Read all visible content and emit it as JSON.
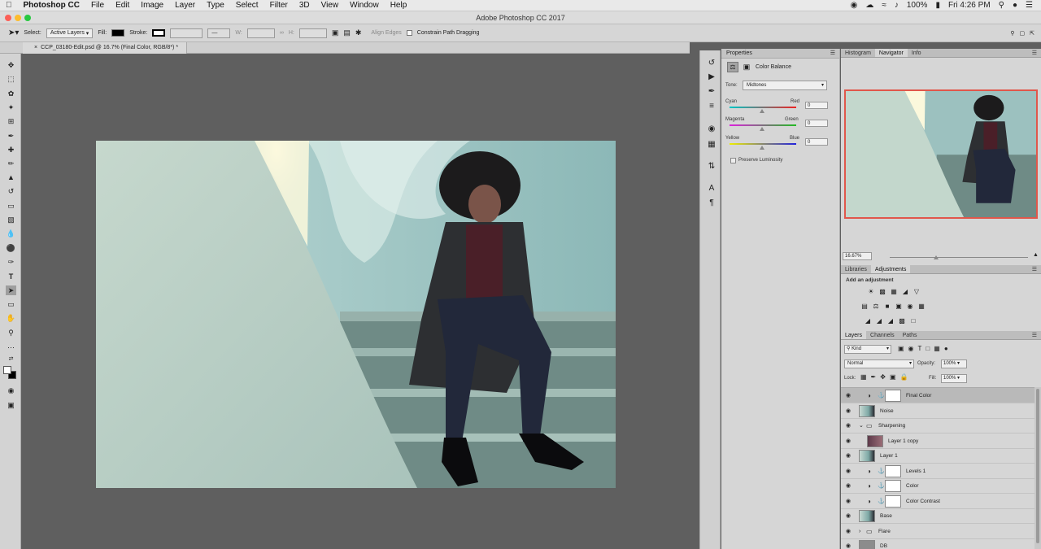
{
  "menubar": {
    "apple": "",
    "app_name": "Photoshop CC",
    "items": [
      "File",
      "Edit",
      "Image",
      "Layer",
      "Type",
      "Select",
      "Filter",
      "3D",
      "View",
      "Window",
      "Help"
    ],
    "battery": "100%",
    "time": "Fri 4:26 PM"
  },
  "window_title": "Adobe Photoshop CC 2017",
  "options": {
    "select_label": "Select:",
    "select_value": "Active Layers",
    "fill_label": "Fill:",
    "stroke_label": "Stroke:",
    "w_label": "W:",
    "h_label": "H:",
    "align_edges": "Align Edges",
    "constrain": "Constrain Path Dragging"
  },
  "document_tab": "CCP_03180-Edit.psd @ 16.7% (Final Color, RGB/8*) *",
  "properties": {
    "title": "Properties",
    "adjustment": "Color Balance",
    "tone_label": "Tone:",
    "tone_value": "Midtones",
    "sliders": [
      {
        "left": "Cyan",
        "right": "Red",
        "value": "0"
      },
      {
        "left": "Magenta",
        "right": "Green",
        "value": "0"
      },
      {
        "left": "Yellow",
        "right": "Blue",
        "value": "0"
      }
    ],
    "preserve": "Preserve Luminosity"
  },
  "nav_tabs": [
    "Histogram",
    "Navigator",
    "Info"
  ],
  "zoom": "16.67%",
  "adj_tabs": [
    "Libraries",
    "Adjustments"
  ],
  "add_adjustment": "Add an adjustment",
  "layer_tabs": [
    "Layers",
    "Channels",
    "Paths"
  ],
  "layers_panel": {
    "kind": "Kind",
    "blend": "Normal",
    "opacity_label": "Opacity:",
    "opacity": "100%",
    "lock_label": "Lock:",
    "fill_label": "Fill:",
    "fill": "100%"
  },
  "layers": [
    {
      "name": "Final Color",
      "type": "adj",
      "selected": true
    },
    {
      "name": "Noise",
      "type": "photo"
    },
    {
      "name": "Sharpening",
      "type": "group-open"
    },
    {
      "name": "Layer 1 copy",
      "type": "photo-dark"
    },
    {
      "name": "Layer 1",
      "type": "photo"
    },
    {
      "name": "Levels 1",
      "type": "adj"
    },
    {
      "name": "Color",
      "type": "adj"
    },
    {
      "name": "Color Contrast",
      "type": "adj"
    },
    {
      "name": "Base",
      "type": "photo"
    },
    {
      "name": "Flare",
      "type": "group"
    },
    {
      "name": "DB",
      "type": "gray"
    }
  ]
}
